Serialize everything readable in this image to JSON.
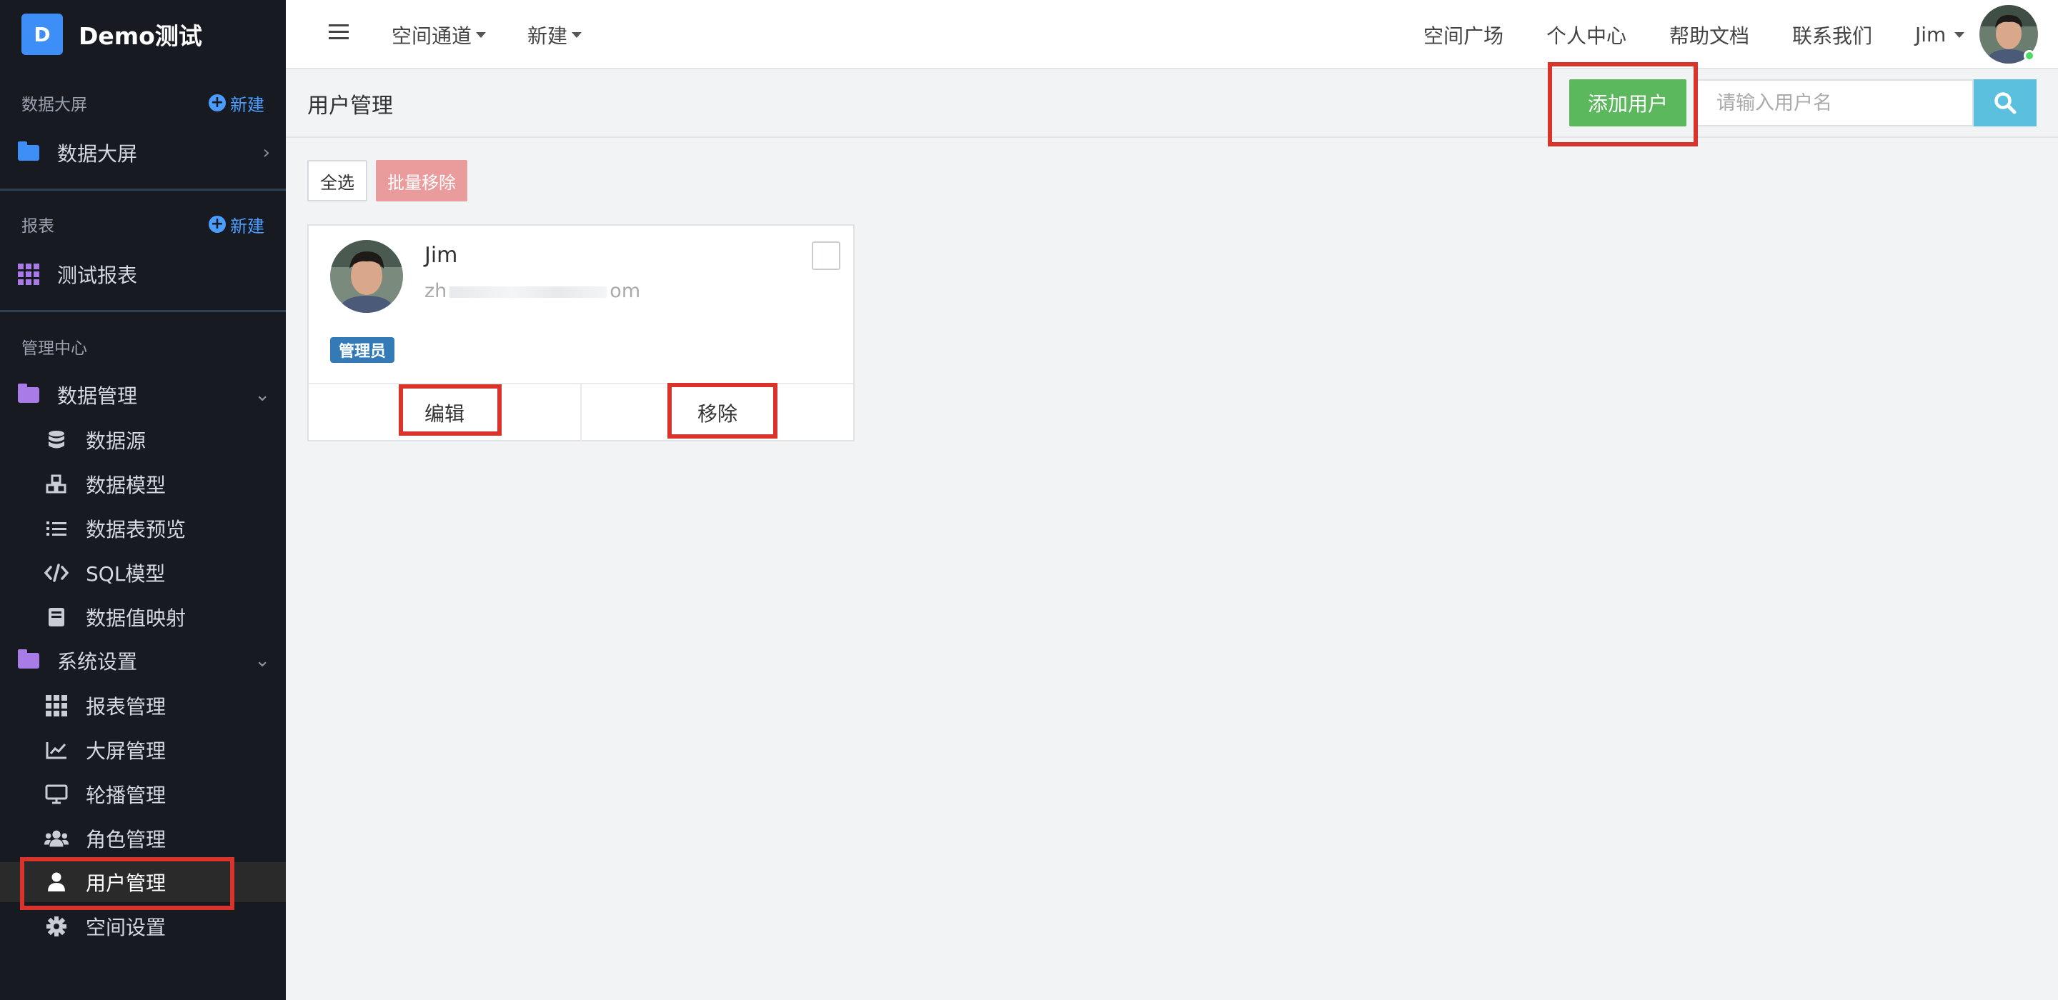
{
  "brand": {
    "letter": "D",
    "title": "Demo测试",
    "color": "#3e8ef7"
  },
  "sidebar": {
    "dashboard_section": {
      "title": "数据大屏",
      "new_label": "新建"
    },
    "dashboard_item": {
      "label": "数据大屏",
      "icon": "folder-icon"
    },
    "report_section": {
      "title": "报表",
      "new_label": "新建"
    },
    "report_item": {
      "label": "测试报表",
      "icon": "grid-icon"
    },
    "admin_section": {
      "title": "管理中心"
    },
    "data_mgmt": {
      "label": "数据管理",
      "items": [
        {
          "label": "数据源",
          "icon": "database-icon"
        },
        {
          "label": "数据模型",
          "icon": "cubes-icon"
        },
        {
          "label": "数据表预览",
          "icon": "list-icon"
        },
        {
          "label": "SQL模型",
          "icon": "code-icon"
        },
        {
          "label": "数据值映射",
          "icon": "book-icon"
        }
      ]
    },
    "sys_settings": {
      "label": "系统设置",
      "items": [
        {
          "label": "报表管理",
          "icon": "grid-icon"
        },
        {
          "label": "大屏管理",
          "icon": "chart-line-icon"
        },
        {
          "label": "轮播管理",
          "icon": "monitor-icon"
        },
        {
          "label": "角色管理",
          "icon": "users-icon"
        },
        {
          "label": "用户管理",
          "icon": "user-icon",
          "active": true
        },
        {
          "label": "空间设置",
          "icon": "gear-icon"
        }
      ]
    }
  },
  "topbar": {
    "space_channel": "空间通道",
    "new": "新建",
    "plaza": "空间广场",
    "personal": "个人中心",
    "help": "帮助文档",
    "contact": "联系我们",
    "user": "Jim"
  },
  "page": {
    "title": "用户管理",
    "add_user": "添加用户",
    "search_placeholder": "请输入用户名",
    "select_all": "全选",
    "batch_remove": "批量移除"
  },
  "users": [
    {
      "name": "Jim",
      "email_prefix": "zh",
      "email_suffix": "om",
      "role": "管理员",
      "edit_label": "编辑",
      "remove_label": "移除"
    }
  ],
  "colors": {
    "sidebar_bg": "#171a21",
    "add_button": "#5cb85c",
    "search_button": "#5bc0de",
    "batch_remove": "#ea9b9b",
    "badge": "#337ab7",
    "highlight": "#d9342b"
  }
}
